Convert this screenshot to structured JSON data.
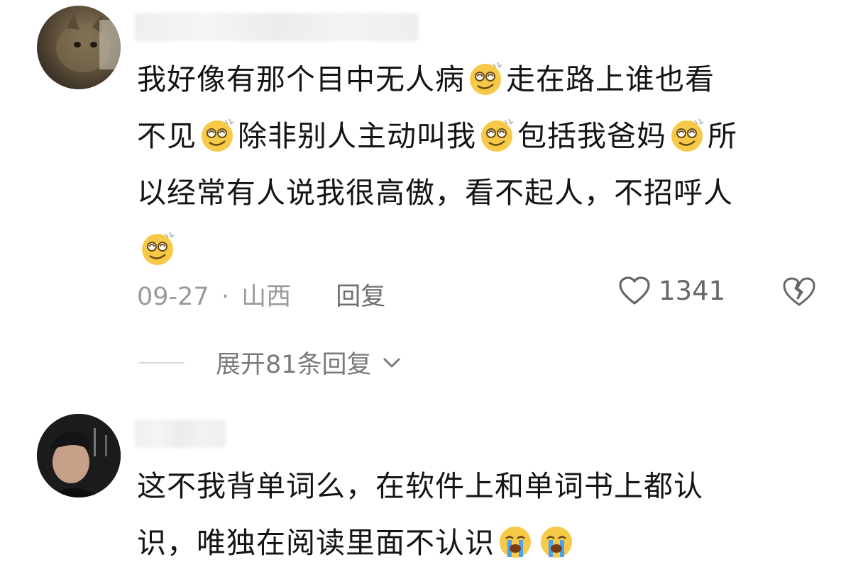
{
  "comments": [
    {
      "text_parts": [
        "我好像有那个目中无人病",
        "走在路上谁也看\n不见",
        "除非别人主动叫我",
        "包括我爸妈",
        "所\n以经常有人说我很高傲，看不起人，不招呼人\n",
        ""
      ],
      "emoji_after": [
        "dizzy-face-emoji",
        "dizzy-face-emoji",
        "dizzy-face-emoji",
        "dizzy-face-emoji",
        "dizzy-face-emoji"
      ],
      "date": "09-27",
      "separator": "·",
      "location": "山西",
      "reply_label": "回复",
      "likes": "1341",
      "expand_label": "展开81条回复"
    },
    {
      "text_parts": [
        "这不我背单词么，在软件上和单词书上都认\n识，唯独在阅读里面不认识"
      ],
      "emoji_after": [
        "crying-face-emoji",
        "crying-face-emoji"
      ]
    }
  ],
  "icons": {
    "like": "heart-outline-icon",
    "dislike": "broken-heart-icon",
    "expand": "chevron-down-icon"
  },
  "colors": {
    "text": "#141414",
    "meta": "#9a9a9a",
    "emoji_face": "#f7c948"
  }
}
